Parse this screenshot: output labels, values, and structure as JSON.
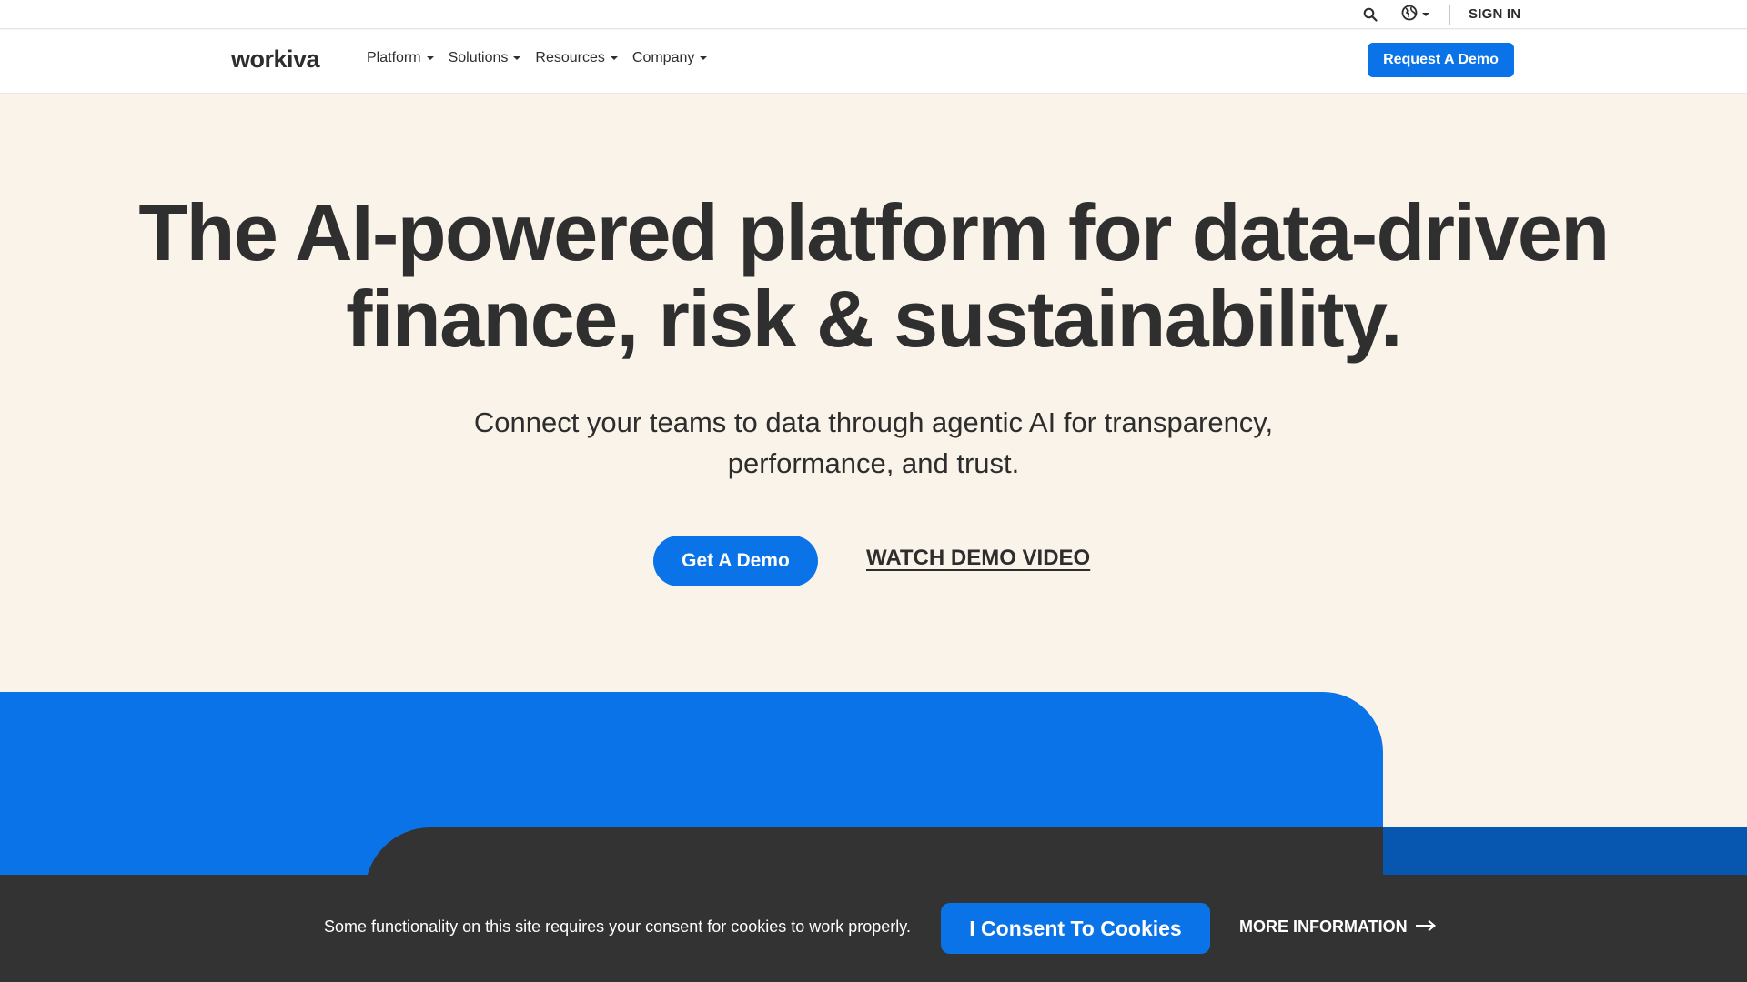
{
  "utility_bar": {
    "search_icon": "search-icon",
    "language_icon": "globe-icon",
    "sign_in_label": "SIGN IN"
  },
  "nav": {
    "logo_text": "workiva",
    "links": [
      {
        "label": "Platform"
      },
      {
        "label": "Solutions"
      },
      {
        "label": "Resources"
      },
      {
        "label": "Company"
      }
    ],
    "cta_label": "Request A Demo"
  },
  "hero": {
    "title_line1": "The AI-powered platform for data-driven",
    "title_line2": "finance, risk & sustainability.",
    "subtitle_line1": "Connect your teams to data through agentic AI for transparency,",
    "subtitle_line2": "performance, and trust.",
    "primary_cta": "Get A Demo",
    "secondary_cta": "WATCH DEMO VIDEO"
  },
  "cookie_banner": {
    "message": "Some functionality on this site requires your consent for cookies to work properly.",
    "consent_label": "I Consent To Cookies",
    "more_info_label": "MORE INFORMATION",
    "more_info_icon": "arrow-right-icon"
  },
  "colors": {
    "accent_blue": "#0a73e8",
    "dark_blue": "#0756b0",
    "hero_background": "#faf3e9",
    "dark_panel": "#333333"
  }
}
